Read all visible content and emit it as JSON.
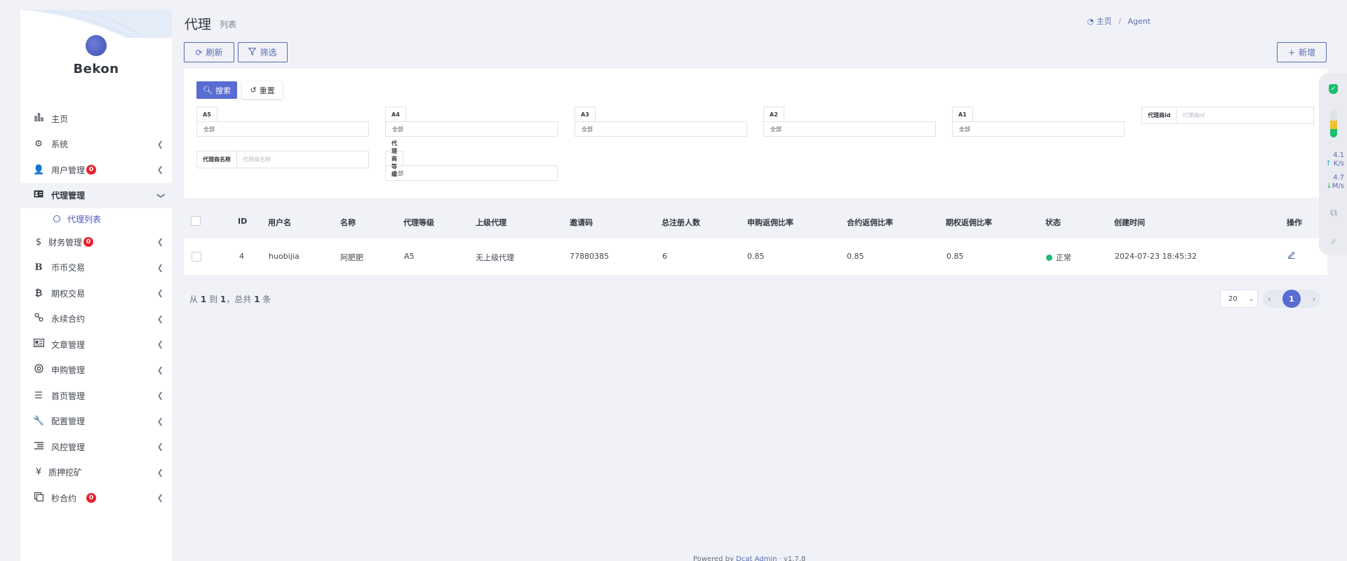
{
  "sidebar": {
    "brand": "Bekon",
    "items": [
      {
        "label": "主页",
        "icon": "bar-chart-icon",
        "chevron": false
      },
      {
        "label": "系统",
        "icon": "gear-icon",
        "chevron": true
      },
      {
        "label": "用户管理",
        "icon": "user-icon",
        "chevron": true,
        "badge": "0"
      },
      {
        "label": "代理管理",
        "icon": "id-card-icon",
        "chevron": true,
        "active": true,
        "expanded": true
      },
      {
        "label": "财务管理",
        "icon": "dollar-icon",
        "chevron": true,
        "badge": "0"
      },
      {
        "label": "币币交易",
        "icon": "bold-b-icon",
        "chevron": true
      },
      {
        "label": "期权交易",
        "icon": "bitcoin-icon",
        "chevron": true
      },
      {
        "label": "永续合约",
        "icon": "link-icon",
        "chevron": true
      },
      {
        "label": "文章管理",
        "icon": "newspaper-icon",
        "chevron": true
      },
      {
        "label": "申购管理",
        "icon": "lifebuoy-icon",
        "chevron": true
      },
      {
        "label": "首页管理",
        "icon": "list-icon",
        "chevron": true
      },
      {
        "label": "配置管理",
        "icon": "wrench-icon",
        "chevron": true
      },
      {
        "label": "风控管理",
        "icon": "indent-list-icon",
        "chevron": true
      },
      {
        "label": "质押挖矿",
        "icon": "yen-icon",
        "chevron": true
      },
      {
        "label": "秒合约",
        "icon": "copy-icon",
        "chevron": true,
        "badge": "0"
      }
    ],
    "submenu": {
      "label": "代理列表"
    }
  },
  "header": {
    "title": "代理",
    "subtitle": "列表",
    "breadcrumb_home": "主页",
    "breadcrumb_current": "Agent"
  },
  "toolbar": {
    "refresh_label": "刷新",
    "filter_label": "筛选",
    "new_label": "新增"
  },
  "filters": {
    "search_label": "搜索",
    "reset_label": "重置",
    "a5": {
      "label": "A5",
      "value": "全部"
    },
    "a4": {
      "label": "A4",
      "value": "全部"
    },
    "a3": {
      "label": "A3",
      "value": "全部"
    },
    "a2": {
      "label": "A2",
      "value": "全部"
    },
    "a1": {
      "label": "A1",
      "value": "全部"
    },
    "agent_id": {
      "label": "代理商id",
      "placeholder": "代理商id"
    },
    "agent_name": {
      "label": "代理商名称",
      "placeholder": "代理商名称"
    },
    "agent_level": {
      "label": "代理商等级",
      "value": "全部"
    }
  },
  "table": {
    "headers": {
      "id": "ID",
      "username": "用户名",
      "name": "名称",
      "level": "代理等级",
      "parent": "上级代理",
      "invite": "邀请码",
      "total_reg": "总注册人数",
      "subscribe_rate": "申购返佣比率",
      "contract_rate": "合约返佣比率",
      "option_rate": "期权返佣比率",
      "status": "状态",
      "created": "创建时间",
      "action": "操作"
    },
    "rows": [
      {
        "id": "4",
        "username": "huobijia",
        "name": "阿肥肥",
        "level": "A5",
        "parent": "无上级代理",
        "invite": "77880385",
        "total_reg": "6",
        "subscribe_rate": "0.85",
        "contract_rate": "0.85",
        "option_rate": "0.85",
        "status": "正常",
        "created": "2024-07-23 18:45:32"
      }
    ]
  },
  "pagination": {
    "summary_prefix": "从",
    "from": "1",
    "to_word": "到",
    "to": "1",
    "total_prefix": "，总共",
    "total": "1",
    "total_suffix": "条",
    "per_page": "20",
    "current_page": "1"
  },
  "footer": {
    "powered_by": "Powered by",
    "link": "Dcat Admin",
    "version": "· v1.7.8"
  },
  "widget": {
    "up_speed": "4.1",
    "up_unit": "K/s",
    "down_speed": "4.7",
    "down_unit": "M/s"
  },
  "colors": {
    "primary": "#586cd1",
    "status_ok": "#21b978",
    "badge": "#e8222e"
  }
}
